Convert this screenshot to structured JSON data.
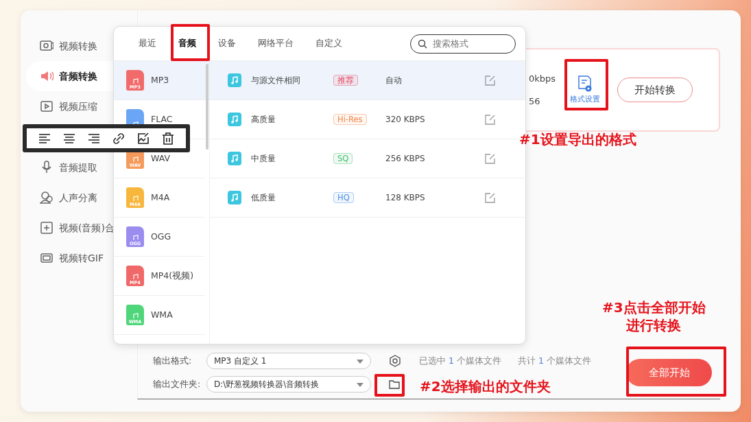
{
  "sidebar": {
    "items": [
      {
        "label": "视频转换",
        "kind": "video",
        "selected": false
      },
      {
        "label": "音频转换",
        "kind": "audio",
        "selected": true
      },
      {
        "label": "视频压缩",
        "kind": "compress",
        "selected": false
      },
      {
        "label": "音频提取",
        "kind": "mic",
        "selected": false
      },
      {
        "label": "人声分离",
        "kind": "voice",
        "selected": false
      },
      {
        "label": "视频(音频)合",
        "kind": "merge",
        "selected": false
      },
      {
        "label": "视频转GIF",
        "kind": "gif",
        "selected": false
      }
    ]
  },
  "file_card": {
    "bitrate": "0kbps",
    "value": "56",
    "format_settings_button": "格式设置",
    "start_button": "开始转换"
  },
  "format_popup": {
    "tabs": [
      {
        "label": "最近",
        "selected": false
      },
      {
        "label": "音频",
        "selected": true
      },
      {
        "label": "设备",
        "selected": false
      },
      {
        "label": "网络平台",
        "selected": false
      },
      {
        "label": "自定义",
        "selected": false
      }
    ],
    "search": {
      "placeholder": "搜索格式"
    },
    "formats": [
      {
        "label": "MP3",
        "icon_label": "MP3",
        "color": "#f26b6b",
        "selected": true
      },
      {
        "label": "FLAC",
        "color": "#6aa6f5",
        "selected": false
      },
      {
        "label": "WAV",
        "icon_label": "WAV",
        "color": "#f59a5a",
        "selected": false
      },
      {
        "label": "M4A",
        "icon_label": "M4A",
        "color": "#f7b63c",
        "selected": false
      },
      {
        "label": "OGG",
        "icon_label": "OGG",
        "color": "#9b8cf0",
        "selected": false
      },
      {
        "label": "MP4(视频)",
        "icon_label": "MP4",
        "color": "#f06868",
        "selected": false
      },
      {
        "label": "WMA",
        "icon_label": "WMA",
        "color": "#4fd67a",
        "selected": false
      }
    ],
    "presets": [
      {
        "name": "与源文件相同",
        "tag": "推荐",
        "color": "#e8445a",
        "bitrate": "自动",
        "selected": true
      },
      {
        "name": "高质量",
        "tag": "Hi-Res",
        "color": "#f0894b",
        "bitrate": "320 KBPS",
        "selected": false
      },
      {
        "name": "中质量",
        "tag": "SQ",
        "color": "#3cbf6a",
        "bitrate": "256 KBPS",
        "selected": false
      },
      {
        "name": "低质量",
        "tag": "HQ",
        "color": "#4a90e2",
        "bitrate": "128 KBPS",
        "selected": false
      }
    ]
  },
  "bottom_bar": {
    "format_label": "输出格式:",
    "format_value": "MP3 自定义 1",
    "selected_prefix": "已选中",
    "selected_count": "1",
    "selected_suffix": "个媒体文件",
    "total_prefix": "共计",
    "total_count": "1",
    "total_suffix": "个媒体文件",
    "folder_label": "输出文件夹:",
    "folder_value": "D:\\野葱视频转换器\\音频转换",
    "start_all_button": "全部开始"
  },
  "annotations": [
    {
      "lines": [
        "#1设置导出的格式"
      ]
    },
    {
      "lines": [
        "#2选择输出的文件夹"
      ]
    },
    {
      "lines": [
        "#3点击全部开始",
        "进行转换"
      ]
    }
  ]
}
